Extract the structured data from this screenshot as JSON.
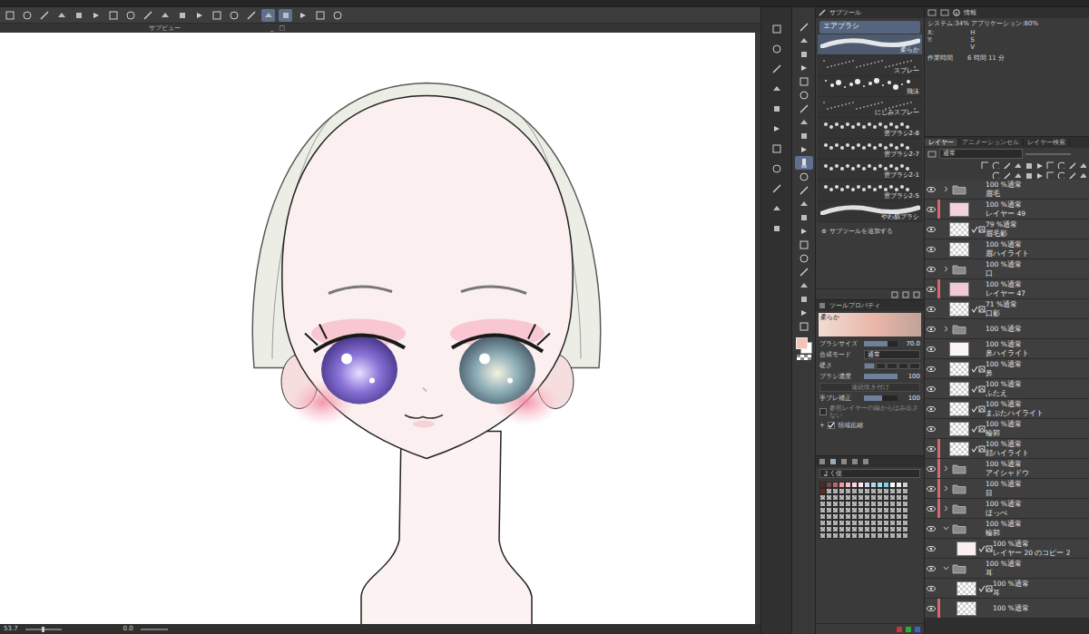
{
  "toolbar": {
    "buttons": [
      {
        "selected": false
      },
      {
        "selected": false
      },
      {
        "selected": false
      },
      {
        "selected": false
      },
      {
        "selected": false
      },
      {
        "selected": false
      },
      {
        "selected": false
      },
      {
        "selected": false
      },
      {
        "selected": false
      },
      {
        "selected": false
      },
      {
        "selected": false
      },
      {
        "selected": false
      },
      {
        "selected": false
      },
      {
        "selected": false
      },
      {
        "selected": false
      },
      {
        "selected": true
      },
      {
        "selected": true
      },
      {
        "selected": false
      },
      {
        "selected": false
      },
      {
        "selected": false
      }
    ]
  },
  "canvas": {
    "title": "サブビュー",
    "window_controls": [
      "_",
      "□"
    ],
    "zoom": "53.7",
    "angle": "0.0"
  },
  "tools": [
    {
      "selected": false
    },
    {
      "selected": false
    },
    {
      "selected": false
    },
    {
      "selected": false
    },
    {
      "selected": false
    },
    {
      "selected": false
    },
    {
      "selected": false
    },
    {
      "selected": false
    },
    {
      "selected": false
    },
    {
      "selected": false
    },
    {
      "selected": true
    },
    {
      "selected": false
    },
    {
      "selected": false
    },
    {
      "selected": false
    },
    {
      "selected": false
    },
    {
      "selected": false
    },
    {
      "selected": false
    },
    {
      "selected": false
    },
    {
      "selected": false
    },
    {
      "selected": false
    },
    {
      "selected": false
    },
    {
      "selected": false
    },
    {
      "selected": false
    }
  ],
  "colors": {
    "main": "#f6c2b4",
    "sub": "#ffffff"
  },
  "subtool": {
    "title": "サブツール",
    "group": "エアブラシ",
    "brushes": [
      {
        "label": "柔らか",
        "kind": "soft",
        "selected": true
      },
      {
        "label": "スプレー",
        "kind": "spray",
        "selected": false
      },
      {
        "label": "飛沫",
        "kind": "splash",
        "selected": false
      },
      {
        "label": "にじみスプレー",
        "kind": "spray",
        "selected": false
      },
      {
        "label": "雲ブラシ2-8",
        "kind": "cloud",
        "selected": false
      },
      {
        "label": "雲ブラシ2-7",
        "kind": "cloud",
        "selected": false
      },
      {
        "label": "雲ブラシ2-1",
        "kind": "cloud",
        "selected": false
      },
      {
        "label": "雲ブラシ2-5",
        "kind": "cloud",
        "selected": false
      },
      {
        "label": "やわ肌ブラシ",
        "kind": "soft",
        "selected": false
      }
    ],
    "add": {
      "icon": "⊕",
      "label": "サブツールを追加する"
    }
  },
  "tool_property": {
    "title": "ツールプロパティ",
    "preview": "柔らか",
    "rows": [
      {
        "kind": "slider",
        "label": "ブラシサイズ",
        "value": "70.0",
        "level": 0.7
      },
      {
        "kind": "select",
        "label": "合成モード",
        "value": "通常"
      },
      {
        "kind": "steps",
        "label": "硬さ",
        "level": 0.2
      },
      {
        "kind": "slider",
        "label": "ブラシ濃度",
        "value": "100",
        "level": 1
      },
      {
        "kind": "button",
        "label": "連続吹き付け",
        "disabled": true
      },
      {
        "kind": "slider",
        "label": "手ブレ補正",
        "value": "100",
        "level": 0.55
      },
      {
        "kind": "check",
        "label": "参照レイヤーの線からはみ出さない",
        "checked": false,
        "disabled": true
      },
      {
        "kind": "check",
        "label": "領域拡縮",
        "icon": "+",
        "checked": true,
        "disabled": false
      }
    ]
  },
  "color_set": {
    "title": "よく使",
    "swatches": [
      {
        "color": "#4a2c2c"
      },
      {
        "color": "#7a4646"
      },
      {
        "color": "#b86a6a"
      },
      {
        "color": "#e89aa6"
      },
      {
        "color": "#f4bcc8"
      },
      {
        "color": "#f9d6de"
      },
      {
        "color": "#ffe9ef"
      },
      {
        "color": "#d8d4ee"
      },
      {
        "color": "#bcd4f0"
      },
      {
        "color": "#9fe0f0"
      },
      {
        "color": "#7ccfe6"
      },
      {
        "color": "#ffffff"
      },
      {
        "color": "#eeeeee"
      },
      {
        "color": "#cfcfcf"
      },
      {
        "color": "#6e2424"
      }
    ]
  },
  "info": {
    "tab": "情報",
    "usage": "システム:34% アプリケーション:80%",
    "coords": [
      "X:",
      "Y:"
    ],
    "hsv": [
      "H",
      "S",
      "V"
    ],
    "time_label": "作業時間",
    "time": "6 時間 11 分"
  },
  "layers": {
    "tabs": [
      {
        "label": "レイヤー",
        "selected": true
      },
      {
        "label": "アニメーションセル",
        "selected": false
      },
      {
        "label": "レイヤー検索",
        "selected": false
      }
    ],
    "blend": "通常",
    "rows": [
      {
        "kind": "folder",
        "opacity": "100 %通常",
        "name": "眉毛",
        "expanded": false,
        "depth": 0,
        "labeled": false,
        "clipped": false,
        "visible": true
      },
      {
        "kind": "layer",
        "opacity": "100 %通常",
        "name": "レイヤー 49",
        "depth": 0,
        "labeled": true,
        "clipped": false,
        "visible": true,
        "color": "#f4d2dc"
      },
      {
        "kind": "layer",
        "opacity": "79 %通常",
        "name": "眉毛影",
        "depth": 0,
        "labeled": false,
        "clipped": true,
        "visible": true
      },
      {
        "kind": "layer",
        "opacity": "100 %通常",
        "name": "眉ハイライト",
        "depth": 0,
        "labeled": false,
        "clipped": false,
        "visible": true
      },
      {
        "kind": "folder",
        "opacity": "100 %通常",
        "name": "口",
        "expanded": false,
        "depth": 0,
        "labeled": false,
        "clipped": false,
        "visible": true
      },
      {
        "kind": "layer",
        "opacity": "100 %通常",
        "name": "レイヤー 47",
        "depth": 0,
        "labeled": true,
        "clipped": false,
        "visible": true,
        "color": "#f2c8d4"
      },
      {
        "kind": "layer",
        "opacity": "71 %通常",
        "name": "口影",
        "depth": 0,
        "labeled": false,
        "clipped": true,
        "visible": true
      },
      {
        "kind": "folder",
        "opacity": "100 %通常",
        "expanded": false,
        "depth": 0,
        "labeled": false,
        "clipped": false,
        "visible": true
      },
      {
        "kind": "layer",
        "opacity": "100 %通常",
        "name": "鼻ハイライト",
        "depth": 0,
        "labeled": false,
        "clipped": false,
        "visible": true,
        "color": "#fbf4f4"
      },
      {
        "kind": "layer",
        "opacity": "100 %通常",
        "name": "鼻",
        "depth": 0,
        "labeled": false,
        "clipped": true,
        "visible": true
      },
      {
        "kind": "layer",
        "opacity": "100 %通常",
        "name": "ふたえ",
        "depth": 0,
        "labeled": false,
        "clipped": true,
        "visible": true
      },
      {
        "kind": "layer",
        "opacity": "100 %通常",
        "name": "まぶたハイライト",
        "depth": 0,
        "labeled": false,
        "clipped": true,
        "visible": true
      },
      {
        "kind": "layer",
        "opacity": "100 %通常",
        "name": "輪郭",
        "depth": 0,
        "labeled": false,
        "clipped": true,
        "visible": true
      },
      {
        "kind": "layer",
        "opacity": "100 %通常",
        "name": "顔ハイライト",
        "depth": 0,
        "labeled": true,
        "clipped": true,
        "visible": true
      },
      {
        "kind": "folder",
        "opacity": "100 %通常",
        "name": "アイシャドウ",
        "expanded": false,
        "depth": 0,
        "labeled": true,
        "clipped": false,
        "visible": true
      },
      {
        "kind": "folder",
        "opacity": "100 %通常",
        "name": "目",
        "expanded": false,
        "depth": 0,
        "labeled": true,
        "clipped": false,
        "visible": true
      },
      {
        "kind": "folder",
        "opacity": "100 %通常",
        "name": "ほっぺ",
        "expanded": false,
        "depth": 0,
        "labeled": true,
        "clipped": false,
        "visible": true
      },
      {
        "kind": "folder",
        "opacity": "100 %通常",
        "name": "輪郭",
        "expanded": true,
        "depth": 0,
        "labeled": false,
        "clipped": false,
        "visible": true
      },
      {
        "kind": "layer",
        "opacity": "100 %通常",
        "name": "レイヤー 20 のコピー 2",
        "depth": 1,
        "labeled": false,
        "clipped": true,
        "visible": true,
        "color": "#fbeeee"
      },
      {
        "kind": "folder",
        "opacity": "100 %通常",
        "name": "耳",
        "expanded": true,
        "depth": 0,
        "labeled": false,
        "clipped": false,
        "visible": true
      },
      {
        "kind": "layer",
        "opacity": "100 %通常",
        "name": "耳",
        "depth": 1,
        "labeled": false,
        "clipped": true,
        "visible": true
      },
      {
        "kind": "layer",
        "opacity": "100 %通常",
        "depth": 1,
        "labeled": true,
        "clipped": false,
        "visible": true
      }
    ]
  }
}
